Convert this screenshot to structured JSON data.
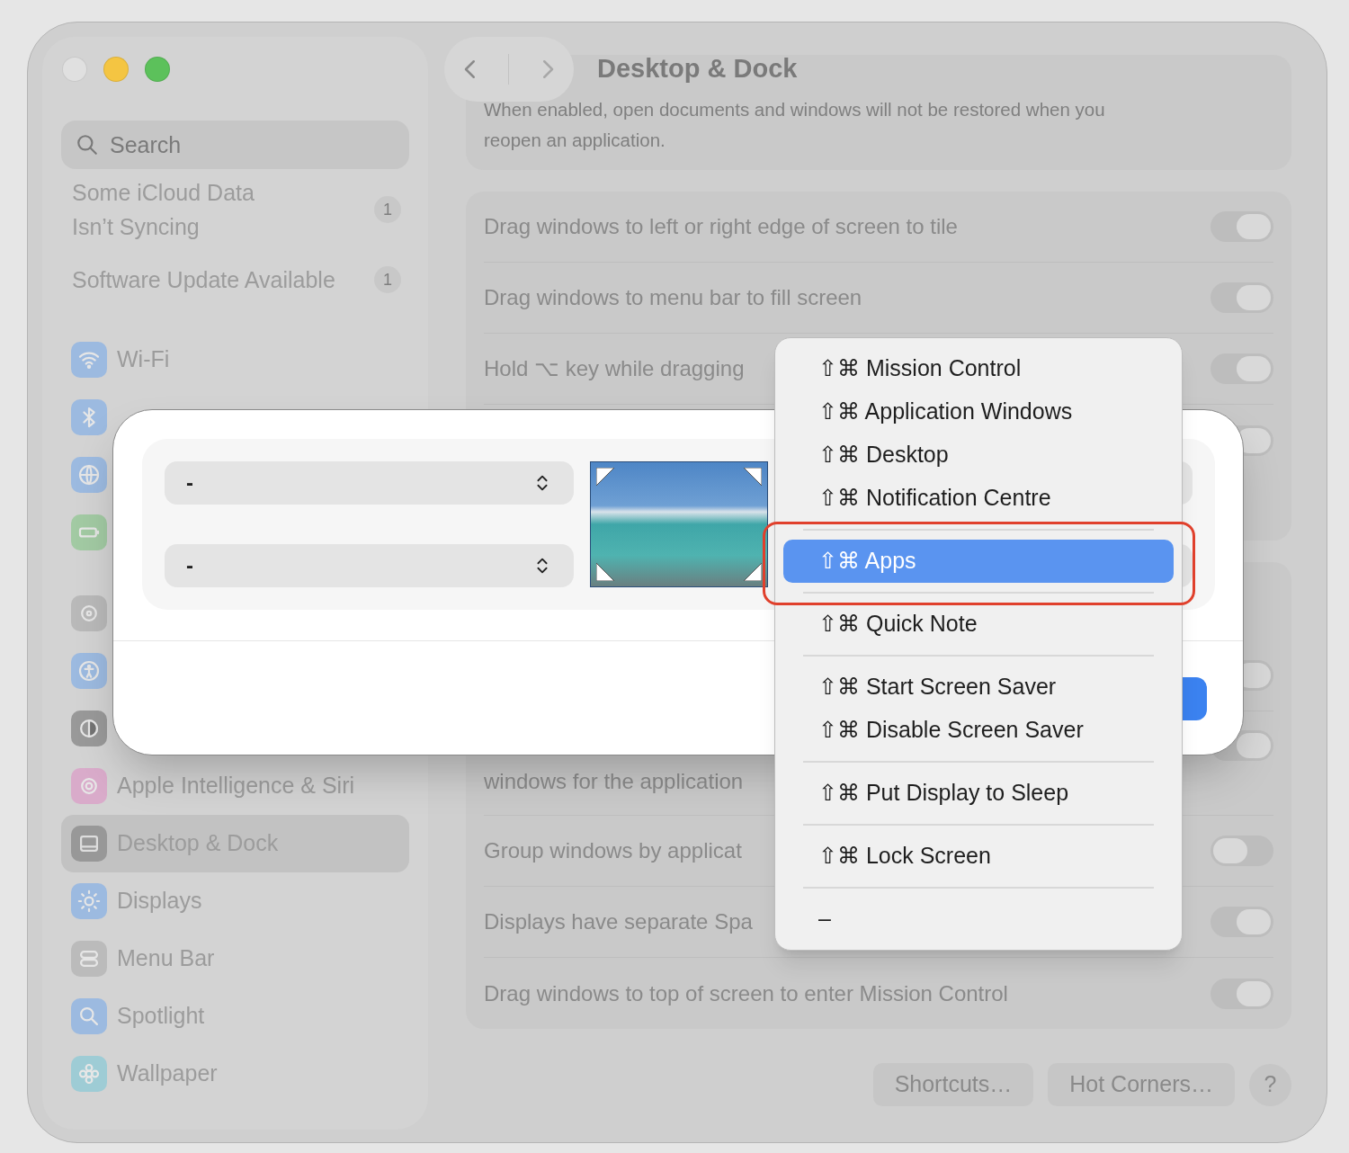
{
  "window": {
    "title": "Desktop & Dock"
  },
  "sidebar": {
    "search": {
      "placeholder": "Search"
    },
    "notices": [
      {
        "label": "Some iCloud Data Isn’t Syncing",
        "badge": "1"
      },
      {
        "label": "Software Update Available",
        "badge": "1"
      }
    ],
    "item_groups": [
      [
        {
          "label": "Wi-Fi",
          "selected": false
        },
        {
          "selected": false
        },
        {
          "selected": false
        },
        {
          "selected": false
        }
      ],
      [
        {
          "selected": false
        },
        {
          "selected": false
        },
        {
          "selected": false
        },
        {
          "label": "Apple Intelligence & Siri",
          "selected": false
        },
        {
          "label": "Desktop & Dock",
          "selected": true
        },
        {
          "label": "Displays",
          "selected": false
        },
        {
          "label": "Menu Bar",
          "selected": false
        },
        {
          "label": "Spotlight",
          "selected": false
        },
        {
          "label": "Wallpaper",
          "selected": false
        }
      ]
    ]
  },
  "main": {
    "intro": "When enabled, open documents and windows will not be restored when you reopen an application.",
    "windows_rows": [
      {
        "kind": "toggle",
        "label": "Drag windows to left or right edge of screen to tile",
        "on": true
      },
      {
        "kind": "toggle",
        "label": "Drag windows to menu bar to fill screen",
        "on": true
      },
      {
        "kind": "toggle",
        "label": "Hold ⌥ key while dragging",
        "on": true
      },
      {
        "kind": "toggle",
        "on": true
      }
    ],
    "mission_rows": [
      {
        "kind": "toggle",
        "on": true
      },
      {
        "kind": "wrapped",
        "label": "windows for the application",
        "on": true
      },
      {
        "kind": "toggle",
        "label": "Group windows by applicat",
        "on": false
      },
      {
        "kind": "toggle",
        "label": "Displays have separate Spa",
        "on": true
      },
      {
        "kind": "toggle",
        "label": "Drag windows to top of screen to enter Mission Control",
        "on": true
      }
    ],
    "buttons": [
      "Shortcuts…",
      "Hot Corners…",
      "?"
    ]
  },
  "dialog": {
    "selects": [
      {
        "value": "-"
      },
      {
        "value": "-"
      }
    ]
  },
  "menu": {
    "groups": [
      [
        {
          "label": "⇧⌘ Mission Control",
          "selected": false
        },
        {
          "label": "⇧⌘ Application Windows",
          "selected": false
        },
        {
          "label": "⇧⌘ Desktop",
          "selected": false
        },
        {
          "label": "⇧⌘ Notification Centre",
          "selected": false
        }
      ],
      [
        {
          "label": "⇧⌘ Apps",
          "selected": true
        }
      ],
      [
        {
          "label": "⇧⌘ Quick Note",
          "selected": false
        }
      ],
      [
        {
          "label": "⇧⌘ Start Screen Saver",
          "selected": false
        },
        {
          "label": "⇧⌘ Disable Screen Saver",
          "selected": false
        }
      ],
      [
        {
          "label": "⇧⌘ Put Display to Sleep",
          "selected": false
        }
      ],
      [
        {
          "label": "⇧⌘ Lock Screen",
          "selected": false
        }
      ],
      [
        {
          "label": "–",
          "selected": false
        }
      ]
    ]
  }
}
